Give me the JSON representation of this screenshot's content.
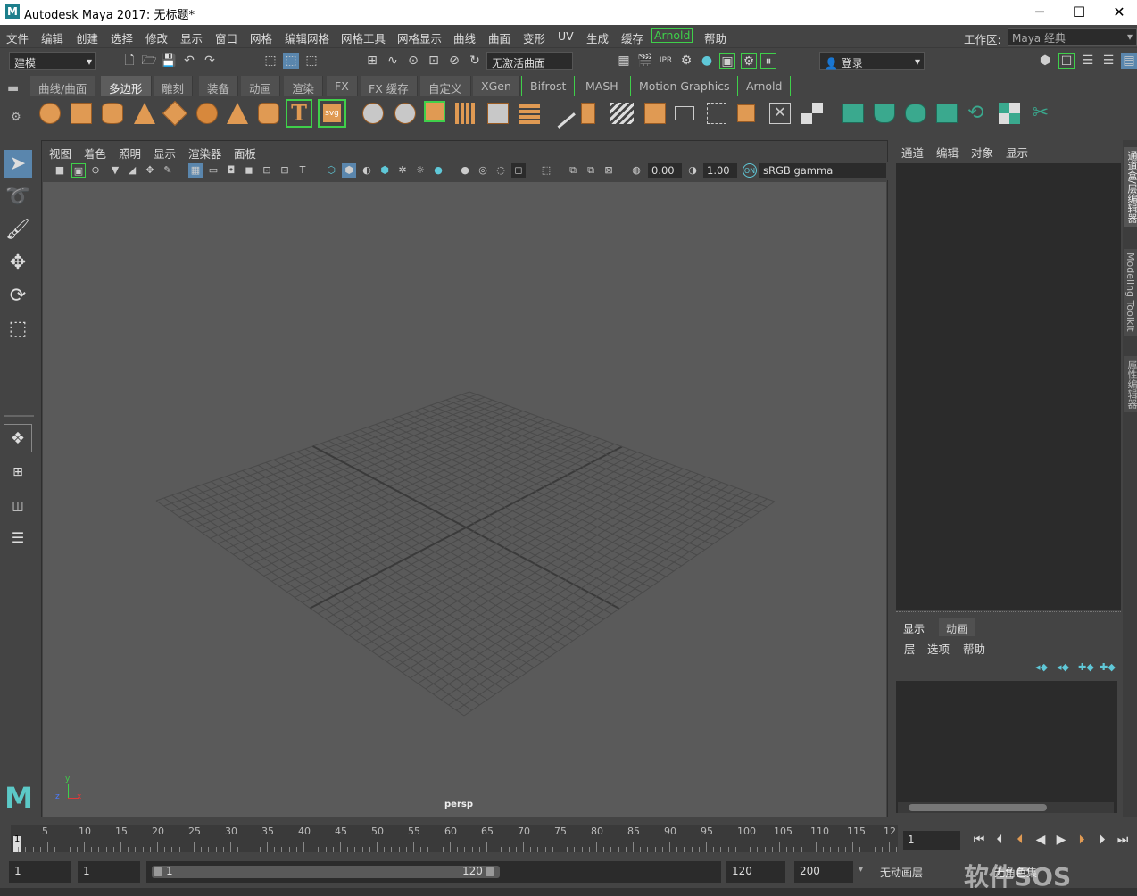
{
  "titlebar": {
    "logo": "M",
    "title": "Autodesk Maya 2017: 无标题*",
    "minimize": "─",
    "maximize": "☐",
    "close": "✕"
  },
  "menubar": {
    "items": [
      "文件",
      "编辑",
      "创建",
      "选择",
      "修改",
      "显示",
      "窗口",
      "网格",
      "编辑网格",
      "网格工具",
      "网格显示",
      "曲线",
      "曲面",
      "变形",
      "UV",
      "生成",
      "缓存",
      "Arnold",
      "帮助"
    ],
    "workspace_label": "工作区:",
    "workspace_value": "Maya 经典"
  },
  "statusline": {
    "mode": "建模",
    "live_surface": "无激活曲面",
    "login": "登录"
  },
  "shelf_tabs": [
    "曲线/曲面",
    "多边形",
    "雕刻",
    "装备",
    "动画",
    "渲染",
    "FX",
    "FX 缓存",
    "自定义",
    "XGen",
    "Bifrost",
    "MASH",
    "Motion Graphics",
    "Arnold"
  ],
  "shelf": {
    "text_tool": "T",
    "svg_tool": "svg"
  },
  "viewport": {
    "menu": [
      "视图",
      "着色",
      "照明",
      "显示",
      "渲染器",
      "面板"
    ],
    "exposure": "0.00",
    "gamma": "1.00",
    "color_space": "sRGB gamma",
    "camera": "persp",
    "axis_y": "y",
    "axis_z": "z",
    "axis_x": "x"
  },
  "right_panel": {
    "menu": [
      "通道",
      "编辑",
      "对象",
      "显示"
    ],
    "layer_tabs": [
      "显示",
      "动画"
    ],
    "layer_menu": [
      "层",
      "选项",
      "帮助"
    ]
  },
  "side_tabs": [
    "通道盒/层编辑器",
    "Modeling Toolkit",
    "属性编辑器"
  ],
  "timeline": {
    "ticks": [
      "1",
      "5",
      "10",
      "15",
      "20",
      "25",
      "30",
      "35",
      "40",
      "45",
      "50",
      "55",
      "60",
      "65",
      "70",
      "75",
      "80",
      "85",
      "90",
      "95",
      "100",
      "105",
      "110",
      "115",
      "12"
    ],
    "current_frame": "1"
  },
  "range": {
    "start": "1",
    "playback_start": "1",
    "slider_start": "1",
    "slider_end": "120",
    "playback_end": "120",
    "end": "200",
    "anim_layer": "无动画层",
    "char_set": "无角色集"
  },
  "watermark": "软件SOS"
}
